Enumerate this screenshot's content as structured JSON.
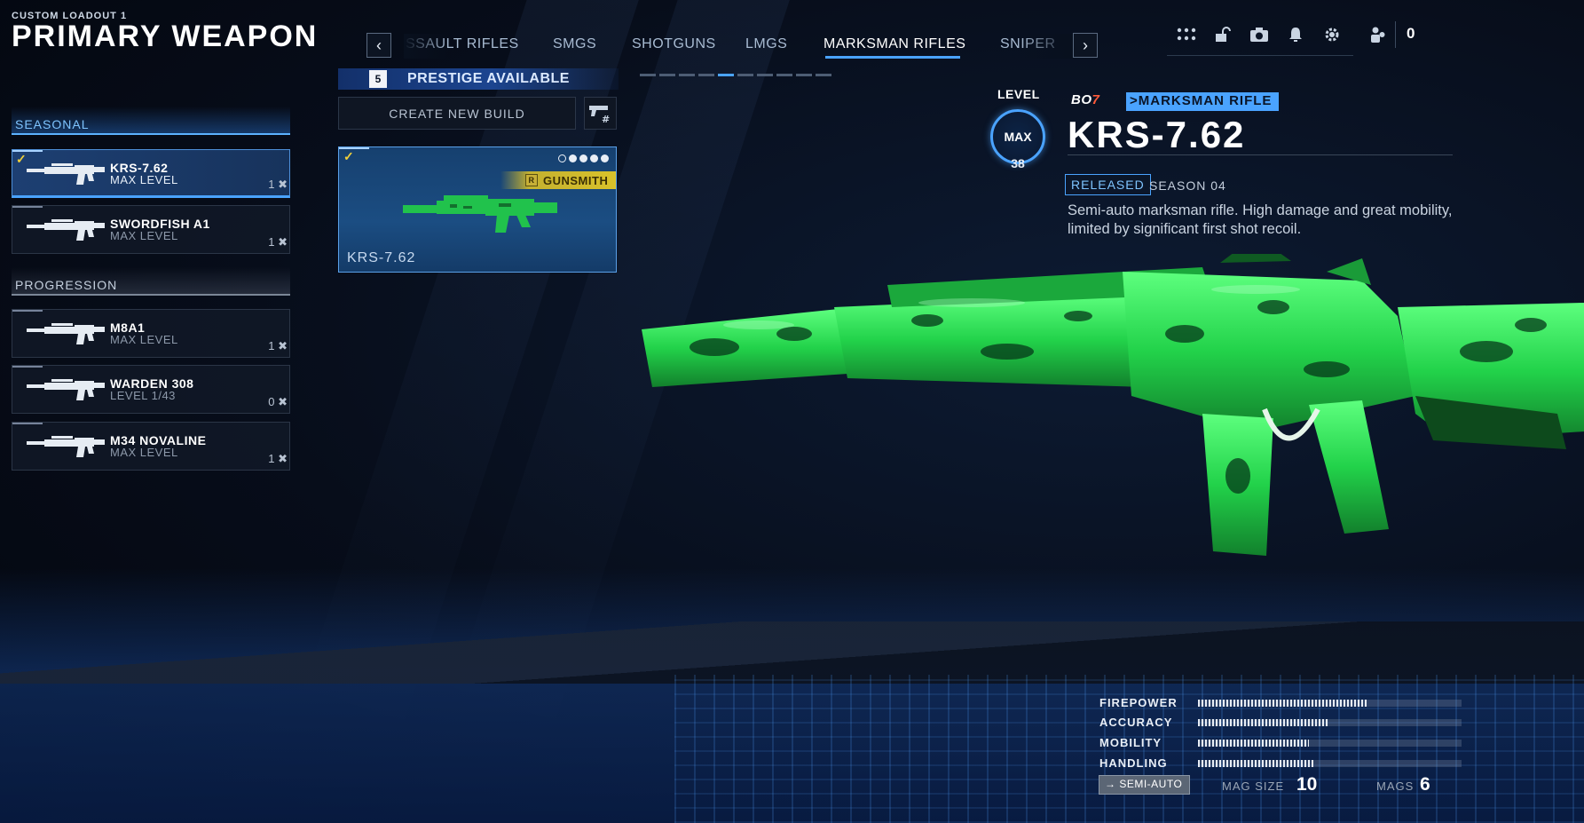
{
  "header": {
    "loadout_label": "CUSTOM LOADOUT 1",
    "title": "PRIMARY WEAPON"
  },
  "category_tabs": {
    "items": [
      "SSAULT RIFLES",
      "SMGS",
      "SHOTGUNS",
      "LMGS",
      "MARKSMAN RIFLES",
      "SNIPER"
    ],
    "active": "MARKSMAN RIFLES",
    "prev_icon": "chevron-left-icon",
    "next_icon": "chevron-right-icon",
    "page_count": 10,
    "active_page": 5
  },
  "top_icons": [
    "apps-grid-icon",
    "unlock-icon",
    "camera-icon",
    "bell-icon",
    "gear-icon",
    "social-icon"
  ],
  "currency": {
    "value": "0"
  },
  "sidebar": {
    "seasonal_label": "SEASONAL",
    "progression_label": "PROGRESSION",
    "seasonal": [
      {
        "name": "KRS-7.62",
        "level": "MAX LEVEL",
        "count": "1",
        "selected": true,
        "equipped": true
      },
      {
        "name": "SWORDFISH A1",
        "level": "MAX LEVEL",
        "count": "1",
        "selected": false,
        "equipped": false
      }
    ],
    "progression": [
      {
        "name": "M8A1",
        "level": "MAX LEVEL",
        "count": "1"
      },
      {
        "name": "WARDEN 308",
        "level": "LEVEL 1/43",
        "count": "0"
      },
      {
        "name": "M34 NOVALINE",
        "level": "MAX LEVEL",
        "count": "1"
      }
    ]
  },
  "builds": {
    "prestige_level": "5",
    "prestige_label": "PRESTIGE AVAILABLE",
    "create_label": "CREATE NEW BUILD",
    "card": {
      "name": "KRS-7.62",
      "tag": "GUNSMITH",
      "tag_icon_letter": "R",
      "attachments_filled": 4,
      "attachments_total": 5
    }
  },
  "weapon": {
    "level_label": "LEVEL",
    "level_max": "MAX",
    "level_number": "38",
    "game_logo_main": "BO",
    "game_logo_accent": "7",
    "class_tag": ">MARKSMAN RIFLE",
    "name": "KRS-7.62",
    "released_label": "RELEASED",
    "season": "SEASON 04",
    "description": "Semi-auto marksman rifle. High damage and great mobility, limited by significant first shot recoil.",
    "camo_color": "#22d24a"
  },
  "stats": {
    "items": [
      {
        "label": "FIREPOWER",
        "value": 0.64
      },
      {
        "label": "ACCURACY",
        "value": 0.49
      },
      {
        "label": "MOBILITY",
        "value": 0.42
      },
      {
        "label": "HANDLING",
        "value": 0.44
      }
    ],
    "fire_mode": "SEMI-AUTO",
    "mag_size_label": "MAG SIZE",
    "mag_size": "10",
    "mags_label": "MAGS",
    "mags": "6"
  },
  "colors": {
    "accent": "#4aa3ff",
    "gunsmith": "#d9c22a",
    "equip": "#f0d03a"
  }
}
